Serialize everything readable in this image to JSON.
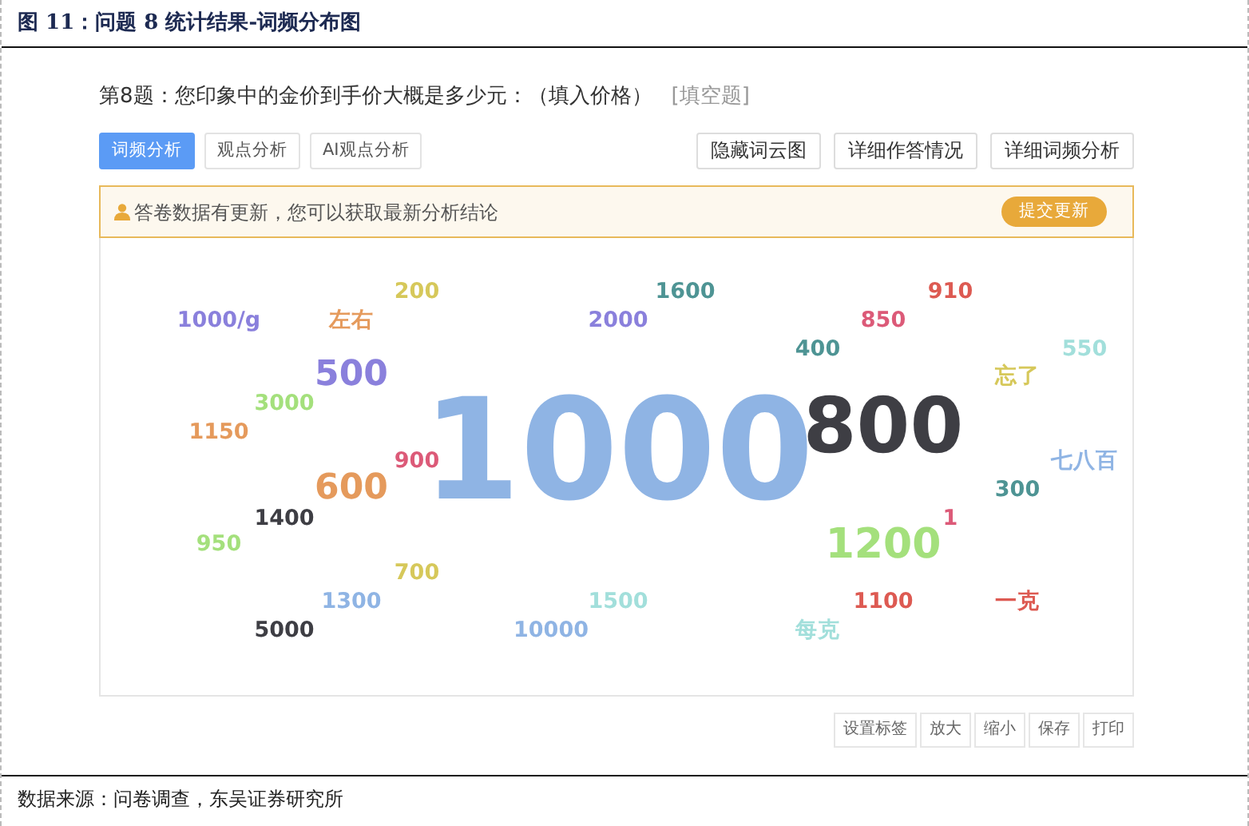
{
  "figure_title": "图 11：问题 8 统计结果-词频分布图",
  "question": {
    "text": "第8题：您印象中的金价到手价大概是多少元：（填入价格）",
    "type": "[填空题]"
  },
  "tabs": [
    {
      "label": "词频分析",
      "selected": true
    },
    {
      "label": "观点分析",
      "selected": false
    },
    {
      "label": "AI观点分析",
      "selected": false
    }
  ],
  "actions": [
    "隐藏词云图",
    "详细作答情况",
    "详细词频分析"
  ],
  "notice": {
    "text": "答卷数据有更新，您可以获取最新分析结论",
    "button": "提交更新"
  },
  "word_cloud": {
    "words": [
      {
        "text": "200",
        "color": "#d6c85a",
        "kind": "sm"
      },
      {
        "text": "1600",
        "color": "#4e9494",
        "kind": "sm"
      },
      {
        "text": "910",
        "color": "#dd5a52",
        "kind": "sm"
      },
      {
        "text": "1000/g",
        "color": "#8a80dc",
        "kind": "sm"
      },
      {
        "text": "左右",
        "color": "#e59a5c",
        "kind": "sm"
      },
      {
        "text": "2000",
        "color": "#8a80dc",
        "kind": "sm"
      },
      {
        "text": "850",
        "color": "#dc5a78",
        "kind": "sm"
      },
      {
        "text": "400",
        "color": "#4e9494",
        "kind": "sm"
      },
      {
        "text": "550",
        "color": "#a2dfdb",
        "kind": "sm"
      },
      {
        "text": "500",
        "color": "#8a80dc",
        "kind": "md"
      },
      {
        "text": "忘了",
        "color": "#d6c85a",
        "kind": "sm"
      },
      {
        "text": "1150",
        "color": "#e59a5c",
        "kind": "sm"
      },
      {
        "text": "3000",
        "color": "#a4e07c",
        "kind": "sm"
      },
      {
        "text": "900",
        "color": "#dc5a78",
        "kind": "sm"
      },
      {
        "text": "600",
        "color": "#e59a5c",
        "kind": "md"
      },
      {
        "text": "1000",
        "color": "#8fb4e4",
        "kind": "xl"
      },
      {
        "text": "800",
        "color": "#3e3e44",
        "kind": "lg"
      },
      {
        "text": "七八百",
        "color": "#8fb4e4",
        "kind": "sm"
      },
      {
        "text": "300",
        "color": "#4e9494",
        "kind": "sm"
      },
      {
        "text": "1400",
        "color": "#3e3e44",
        "kind": "sm"
      },
      {
        "text": "1",
        "color": "#dc5a78",
        "kind": "sm"
      },
      {
        "text": "950",
        "color": "#a4e07c",
        "kind": "sm"
      },
      {
        "text": "1200",
        "color": "#a4e07c",
        "kind": "ml"
      },
      {
        "text": "700",
        "color": "#d6c85a",
        "kind": "sm"
      },
      {
        "text": "1300",
        "color": "#8fb4e4",
        "kind": "sm"
      },
      {
        "text": "1500",
        "color": "#a2dfdb",
        "kind": "sm"
      },
      {
        "text": "1100",
        "color": "#dd5a52",
        "kind": "sm"
      },
      {
        "text": "一克",
        "color": "#dd5a52",
        "kind": "sm"
      },
      {
        "text": "5000",
        "color": "#3e3e44",
        "kind": "sm"
      },
      {
        "text": "10000",
        "color": "#8fb4e4",
        "kind": "sm"
      },
      {
        "text": "每克",
        "color": "#a2dfdb",
        "kind": "sm"
      }
    ]
  },
  "cloud_toolbar": [
    "设置标签",
    "放大",
    "缩小",
    "保存",
    "打印"
  ],
  "source": "数据来源：问卷调查，东吴证券研究所"
}
